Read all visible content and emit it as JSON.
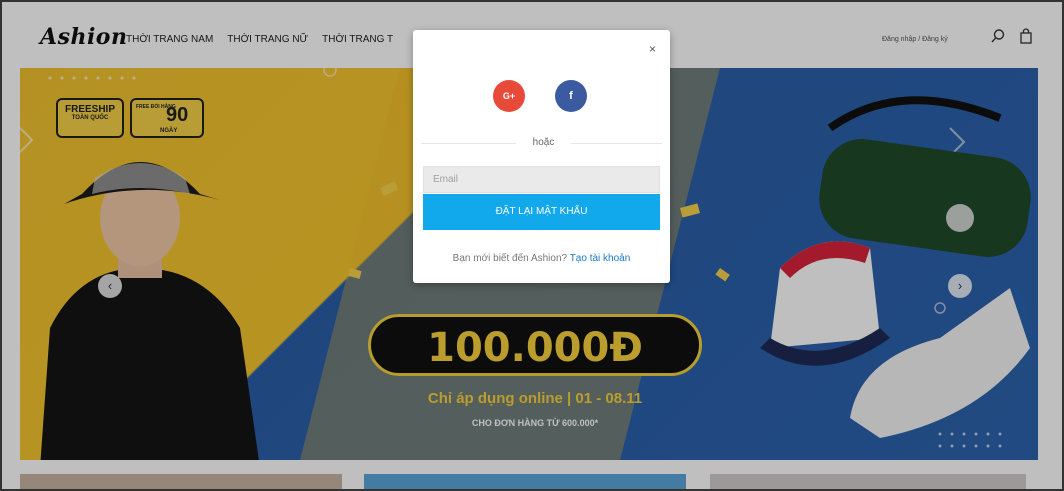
{
  "header": {
    "logo": "Ashion",
    "nav": [
      "THỜI TRANG NAM",
      "THỜI TRANG NỮ",
      "THỜI TRANG T"
    ],
    "auth_text": "Đăng nhập / Đăng ký",
    "icons": [
      "search-icon",
      "bag-icon"
    ]
  },
  "banner": {
    "badge_freeship": "FREESHIP",
    "badge_freeship_sub": "TOÀN QUỐC",
    "badge_free_label": "FREE ĐỔI HÀNG",
    "badge_days_number": "90",
    "badge_days_label": "NGÀY",
    "promo_amount": "100.000Đ",
    "promo_sub": "Chỉ áp dụng online | 01 - 08.11",
    "promo_condition": "CHO ĐƠN HÀNG TỪ 600.000*",
    "prev_icon": "chevron-left-icon",
    "next_icon": "chevron-right-icon"
  },
  "modal": {
    "google_label": "G+",
    "facebook_label": "f",
    "or_text": "hoặc",
    "email_placeholder": "Email",
    "reset_button": "ĐẶT LẠI MẬT KHẨU",
    "signup_prompt": "Bạn mới biết đến Ashion?",
    "signup_link": "Tạo tài khoản",
    "close_icon": "×"
  },
  "colors": {
    "google": "#e84a3a",
    "facebook": "#3b5a9f",
    "primary": "#12a8ec",
    "link": "#1a78c8",
    "banner_yellow": "#f4c52e",
    "banner_blue": "#2d63ae"
  }
}
